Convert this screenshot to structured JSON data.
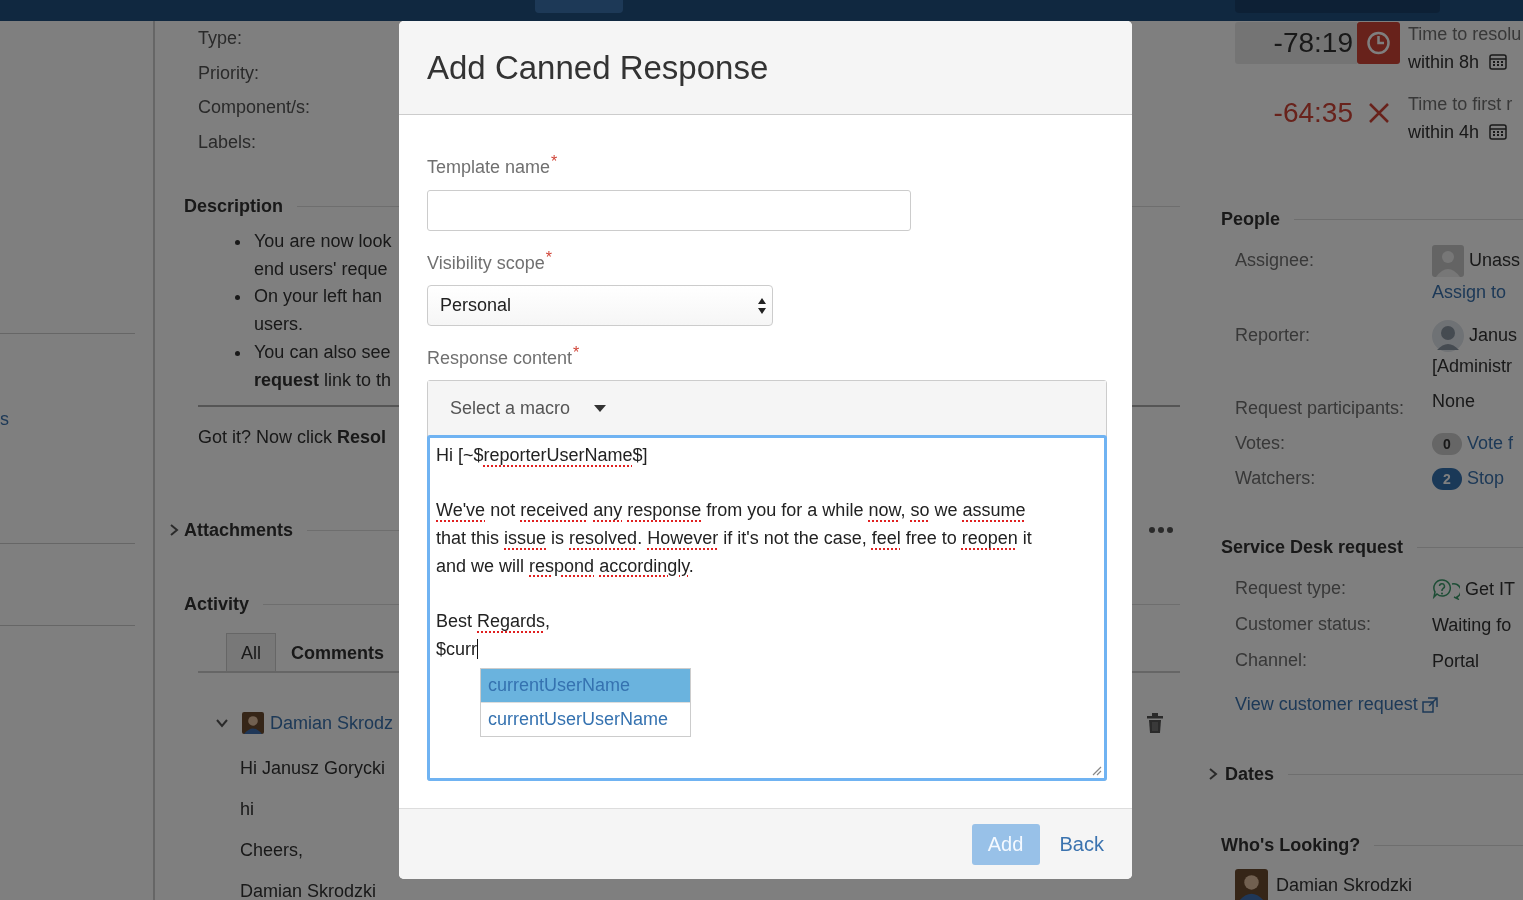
{
  "nav_panel": {
    "link": "s"
  },
  "details": {
    "labels": [
      "Type:",
      "Priority:",
      "Component/s:",
      "Labels:"
    ]
  },
  "description": {
    "title": "Description",
    "bullets": [
      [
        "You are now look",
        "end users' reque"
      ],
      [
        "On your left han",
        "users."
      ],
      [
        "You can also see",
        "**request** link to th"
      ]
    ],
    "note": "Got it? Now click **Resol**"
  },
  "attachments": {
    "title": "Attachments",
    "expanded": false
  },
  "activity": {
    "title": "Activity",
    "tabs": [
      {
        "label": "All",
        "selected": false
      },
      {
        "label": "Comments",
        "selected": true
      }
    ],
    "comment": {
      "author": "Damian Skrodz",
      "expanded": true,
      "lines": [
        "Hi Janusz Gorycki",
        "hi",
        "Cheers,",
        "Damian Skrodzki"
      ]
    }
  },
  "sla": [
    {
      "kind": "running",
      "time": "-78:19",
      "title": "Time to resolu",
      "goal": "within 8h"
    },
    {
      "kind": "breached",
      "time": "-64:35",
      "title": "Time to first r",
      "goal": "within 4h"
    }
  ],
  "people": {
    "title": "People",
    "rows": [
      {
        "kind": "unassigned",
        "label": "Assignee:",
        "value": "Unass",
        "link": "Assign to"
      },
      {
        "kind": "user",
        "label": "Reporter:",
        "value": "Janus",
        "note": "[Administr"
      },
      {
        "kind": "text",
        "label": "Request participants:",
        "value": "None"
      },
      {
        "kind": "count",
        "label": "Votes:",
        "count": "0",
        "on": false,
        "link": "Vote f"
      },
      {
        "kind": "count",
        "label": "Watchers:",
        "count": "2",
        "on": true,
        "link": "Stop"
      }
    ]
  },
  "service_desk": {
    "title": "Service Desk request",
    "rows": [
      {
        "label": "Request type:",
        "value": "Get IT",
        "icon": true
      },
      {
        "label": "Customer status:",
        "value": "Waiting fo",
        "icon": false
      },
      {
        "label": "Channel:",
        "value": "Portal",
        "icon": false
      }
    ],
    "link": "View customer request"
  },
  "dates": {
    "title": "Dates",
    "expanded": false
  },
  "whos_looking": {
    "title": "Who's Looking?",
    "users": [
      "Damian Skrodzki"
    ]
  },
  "dialog": {
    "title": "Add Canned Response",
    "template_name": {
      "label": "Template name",
      "required_mark": "*"
    },
    "visibility_scope": {
      "label": "Visibility scope",
      "required_mark": "*",
      "value": "Personal"
    },
    "response_content": {
      "label": "Response content",
      "required_mark": "*",
      "macro": "Select a macro",
      "paragraphs": [
        [
          [
            {
              "text": "Hi [~$"
            },
            {
              "text": "reporterUserName",
              "flagged": true
            },
            {
              "text": "$]"
            }
          ]
        ],
        [
          [
            {
              "text": "We've",
              "flagged": true
            },
            {
              "text": " not "
            },
            {
              "text": "received",
              "flagged": true
            },
            {
              "text": " any",
              "flagged": true
            },
            {
              "text": " response",
              "flagged": true
            },
            {
              "text": " from you for a while "
            },
            {
              "text": "now",
              "flagged": true
            },
            {
              "text": ", "
            },
            {
              "text": "so",
              "flagged": true
            },
            {
              "text": " we "
            },
            {
              "text": "assume",
              "flagged": true
            }
          ],
          [
            {
              "text": "that this "
            },
            {
              "text": "issue",
              "flagged": true
            },
            {
              "text": " is "
            },
            {
              "text": "resolved",
              "flagged": true
            },
            {
              "text": ". "
            },
            {
              "text": "However",
              "flagged": true
            },
            {
              "text": " if it's not the case, "
            },
            {
              "text": "feel",
              "flagged": true
            },
            {
              "text": " free to "
            },
            {
              "text": "reopen",
              "flagged": true
            },
            {
              "text": " it"
            }
          ],
          [
            {
              "text": "and we will "
            },
            {
              "text": "respond",
              "flagged": true
            },
            {
              "text": " accordingly",
              "flagged": true
            },
            {
              "text": "."
            }
          ]
        ],
        [
          [
            {
              "text": "Best "
            },
            {
              "text": "Regards",
              "flagged": true
            },
            {
              "text": ","
            }
          ],
          [
            {
              "text": "$curr",
              "caret": true
            }
          ]
        ]
      ],
      "suggestions": [
        {
          "label": "currentUserName",
          "selected": true
        },
        {
          "label": "currentUserUserName",
          "selected": false
        }
      ]
    },
    "buttons": [
      {
        "kind": "primary",
        "label": "Add",
        "disabled": true
      },
      {
        "kind": "link",
        "label": "Back",
        "disabled": false
      }
    ]
  }
}
